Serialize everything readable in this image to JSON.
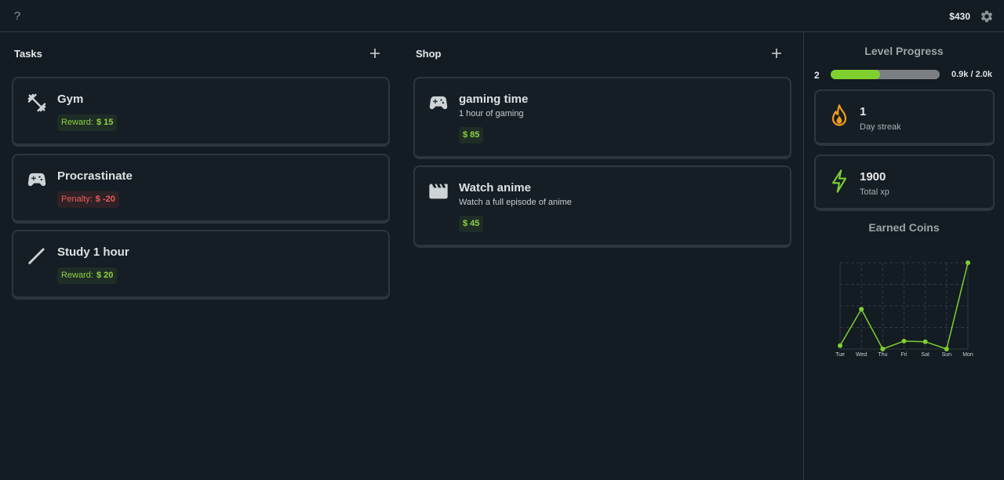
{
  "topbar": {
    "help_label": "?",
    "balance": "$430",
    "settings_icon": "gear-icon"
  },
  "tasks": {
    "title": "Tasks",
    "items": [
      {
        "icon": "dumbbell-icon",
        "title": "Gym",
        "chip_label": "Reward:",
        "chip_value": "$ 15",
        "kind": "reward"
      },
      {
        "icon": "gamepad-icon",
        "title": "Procrastinate",
        "chip_label": "Penalty:",
        "chip_value": "$ -20",
        "kind": "penalty"
      },
      {
        "icon": "pencil-icon",
        "title": "Study 1 hour",
        "chip_label": "Reward:",
        "chip_value": "$ 20",
        "kind": "reward"
      }
    ]
  },
  "shop": {
    "title": "Shop",
    "items": [
      {
        "icon": "gamepad-icon",
        "title": "gaming time",
        "desc": "1 hour of gaming",
        "price": "$ 85"
      },
      {
        "icon": "clapperboard-icon",
        "title": "Watch anime",
        "desc": "Watch a full episode of anime",
        "price": "$ 45"
      }
    ]
  },
  "level": {
    "title": "Level Progress",
    "level": "2",
    "progress_text": "0.9k / 2.0k",
    "fraction": 0.45
  },
  "stats": [
    {
      "icon": "flame-icon",
      "value": "1",
      "label": "Day streak",
      "color": "#f29a1a"
    },
    {
      "icon": "lightning-icon",
      "value": "1900",
      "label": "Total xp",
      "color": "#7fcf2e"
    }
  ],
  "colors": {
    "accent": "#7fcf2e",
    "penalty": "#ea5c5c",
    "background": "#131c22",
    "card": "#151e24"
  },
  "chart_data": {
    "type": "line",
    "title": "Earned Coins",
    "categories": [
      "Tue",
      "Wed",
      "Thu",
      "Fri",
      "Sat",
      "Sun",
      "Mon"
    ],
    "values": [
      5,
      60,
      0,
      12,
      11,
      0,
      130
    ],
    "ylim": [
      0,
      130
    ],
    "grid": true,
    "color": "#7fcf2e"
  }
}
